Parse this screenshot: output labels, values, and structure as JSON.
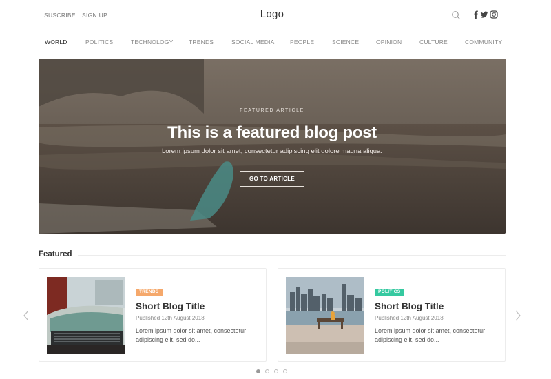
{
  "topbar": {
    "subscribe_label": "SUSCRIBE",
    "signup_label": "SIGN UP",
    "logo_text": "Logo",
    "icons": [
      "search-icon",
      "facebook-icon",
      "twitter-icon",
      "instagram-icon"
    ]
  },
  "nav": {
    "items": [
      {
        "label": "WORLD",
        "active": true
      },
      {
        "label": "POLITICS"
      },
      {
        "label": "TECHNOLOGY"
      },
      {
        "label": "TRENDS"
      },
      {
        "label": "SOCIAL MEDIA"
      },
      {
        "label": "PEOPLE"
      },
      {
        "label": "SCIENCE"
      },
      {
        "label": "OPINION"
      },
      {
        "label": "CULTURE"
      },
      {
        "label": "COMMUNITY"
      }
    ]
  },
  "hero": {
    "kicker": "FEATURED ARTICLE",
    "title": "This is a featured blog post",
    "subtitle": "Lorem ipsum dolor sit amet, consectetur adipiscing elit dolore magna aliqua.",
    "button_label": "GO TO ARTICLE"
  },
  "featured": {
    "heading": "Featured",
    "cards": [
      {
        "badge": "TRENDS",
        "badge_color": "#f5a86b",
        "title": "Short Blog Title",
        "date": "Published 12th August 2018",
        "excerpt": "Lorem ipsum dolor sit amet, consectetur adipiscing elit, sed do..."
      },
      {
        "badge": "POLITICS",
        "badge_color": "#35c9a0",
        "title": "Short Blog Title",
        "date": "Published 12th August 2018",
        "excerpt": "Lorem ipsum dolor sit amet, consectetur adipiscing elit, sed do..."
      }
    ],
    "pagination": {
      "total": 4,
      "active": 1
    }
  },
  "colors": {
    "text_dark": "#333333",
    "text_muted": "#888888",
    "border": "#ececec"
  }
}
